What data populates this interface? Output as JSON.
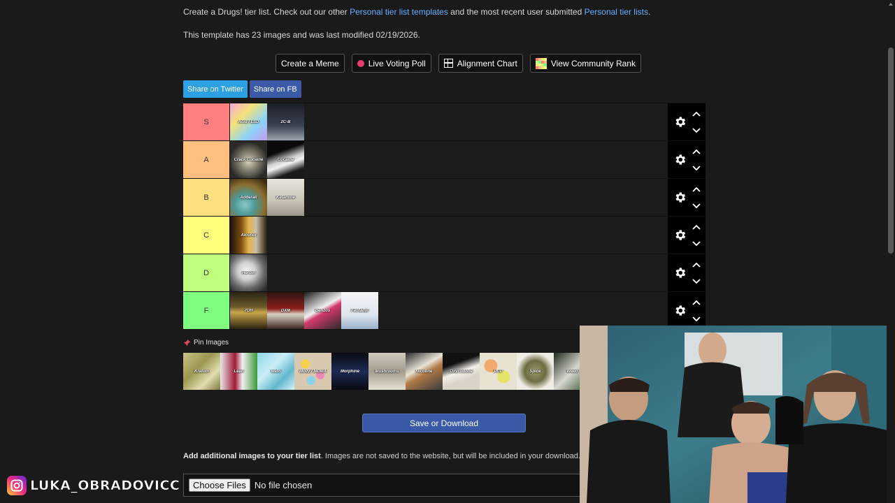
{
  "intro": {
    "prefix": "Create a Drugs! tier list. Check out our other ",
    "link1": "Personal tier list templates",
    "middle": " and the most recent user submitted ",
    "link2": "Personal tier lists",
    "suffix": "."
  },
  "modified_text": "This template has 23 images and was last modified 02/19/2026.",
  "toolbar": {
    "meme": "Create a Meme",
    "poll": "Live Voting Poll",
    "alignment": "Alignment Chart",
    "community": "View Community Rank"
  },
  "share": {
    "twitter": "Share on Twitter",
    "fb": "Share on FB"
  },
  "tiers": [
    {
      "label": "S",
      "color": "#ff7f7f",
      "items": [
        {
          "caption": "Acid / LSD",
          "bg": "linear-gradient(135deg,#f7a8d8,#f6e27a,#8bd3f7,#c79bf2)"
        },
        {
          "caption": "2C-B",
          "bg": "linear-gradient(180deg,#1b1e26,#3a4150 60%,#9aa3ad)"
        }
      ]
    },
    {
      "label": "A",
      "color": "#ffbf7f",
      "items": [
        {
          "caption": "Crack Cocaine",
          "bg": "radial-gradient(circle at 50% 55%,#d9d3bf 0,#8b8677 30%,#2b2a27 70%)"
        },
        {
          "caption": "Cocaine",
          "bg": "linear-gradient(160deg,#0a0a0a 30%,#cfcfcf 50%,#f2f2f2 60%,#1a1a1a 80%)"
        }
      ]
    },
    {
      "label": "B",
      "color": "#ffdf7f",
      "items": [
        {
          "caption": "Adderall",
          "bg": "radial-gradient(circle at 40% 70%,#87c8c8 0,#4e9a98 30%,#8a6d2f 60%,#3a2a12 90%)"
        },
        {
          "caption": "Ketamine",
          "bg": "linear-gradient(180deg,#e8e4da,#c9c4b7 60%,#9b9488)"
        }
      ]
    },
    {
      "label": "C",
      "color": "#ffff7f",
      "items": [
        {
          "caption": "Alcohol",
          "bg": "linear-gradient(90deg,#1a1208,#7a4e12 30%,#e2b347 50%,#c8c0a8 70%,#2a1e0c)"
        }
      ]
    },
    {
      "label": "D",
      "color": "#bfff7f",
      "items": [
        {
          "caption": "Heroin",
          "bg": "radial-gradient(circle at 45% 45%,#f4f4f4 0,#cfcfcf 30%,#6a6a6a 60%,#2a2a2a 90%)"
        }
      ]
    },
    {
      "label": "F",
      "color": "#7fff7f",
      "items": [
        {
          "caption": "7OH",
          "bg": "linear-gradient(180deg,#2b2316,#6b5a2a 40%,#c7a64a 55%,#2a2112)"
        },
        {
          "caption": "DXM",
          "bg": "linear-gradient(180deg,#2a1412,#8b1f1a 45%,#d9d1c4 60%,#3a2520)"
        },
        {
          "caption": "Benzos",
          "bg": "linear-gradient(150deg,#1a1a1a,#f0f0f0 45%,#d33a6a 55%,#2a2a2a)"
        },
        {
          "caption": "Fentanyl",
          "bg": "linear-gradient(180deg,#f3f5f8,#dfe6ee 60%,#9ab0c8)"
        }
      ]
    }
  ],
  "pin": {
    "title": "Pin Images",
    "items": [
      {
        "caption": "Kratom",
        "bg": "linear-gradient(135deg,#c9c38a,#9a9650 40%,#e3ddb0 70%,#7d7a40)"
      },
      {
        "caption": "Lean",
        "bg": "linear-gradient(90deg,#e7e7e7,#a11b39 40%,#f0f0f0 60%,#3b9a3a)"
      },
      {
        "caption": "Meth",
        "bg": "linear-gradient(135deg,#8fd6e8,#c9eef5 40%,#62b7cf 70%,#d7f3f8)"
      },
      {
        "caption": "Molly / MDMA",
        "bg": "radial-gradient(circle at 30% 30%,#f5d04a 0,#f5d04a 12%,transparent 13%),radial-gradient(circle at 70% 60%,#f08ab3 0,#f08ab3 12%,transparent 13%),radial-gradient(circle at 45% 75%,#8ad3e8 0,#8ad3e8 12%,transparent 13%),#d8c8b0"
      },
      {
        "caption": "Morphine",
        "bg": "linear-gradient(180deg,#0a0a10,#1c2a55 50%,#0a0a10)"
      },
      {
        "caption": "Mushrooms",
        "bg": "linear-gradient(180deg,#cfc9bf,#a39c8e 50%,#e6e0d4)"
      },
      {
        "caption": "Nicotine",
        "bg": "linear-gradient(150deg,#2b2b2b,#e9e3d6 40%,#b07a46 55%,#3b3b3b)"
      },
      {
        "caption": "Oxycodone",
        "bg": "linear-gradient(160deg,#111 30%,#f3efe8 50%,#d9d3c8 70%)"
      },
      {
        "caption": "PCP",
        "bg": "radial-gradient(circle at 30% 35%,#f3a96a 0,#f3a96a 18%,transparent 19%),radial-gradient(circle at 65% 65%,#e3e46a 0,#e3e46a 18%,transparent 19%),#e7e2d2"
      },
      {
        "caption": "Spice",
        "bg": "radial-gradient(circle at 50% 50%,#9b9a6a 0,#6e6c42 40%,#efece4 70%)"
      },
      {
        "caption": "Weed",
        "bg": "linear-gradient(135deg,#1d2a1a,#d7d7d0 50%,#2f4a26)"
      }
    ]
  },
  "save_label": "Save or Download",
  "add_images": {
    "bold": "Add additional images to your tier list",
    "rest": ". Images are not saved to the website, but will be included in your download."
  },
  "file_input": {
    "button": "Choose Files",
    "status": "No file chosen"
  },
  "instagram": {
    "handle": "LUKA_OBRADOVICC"
  }
}
